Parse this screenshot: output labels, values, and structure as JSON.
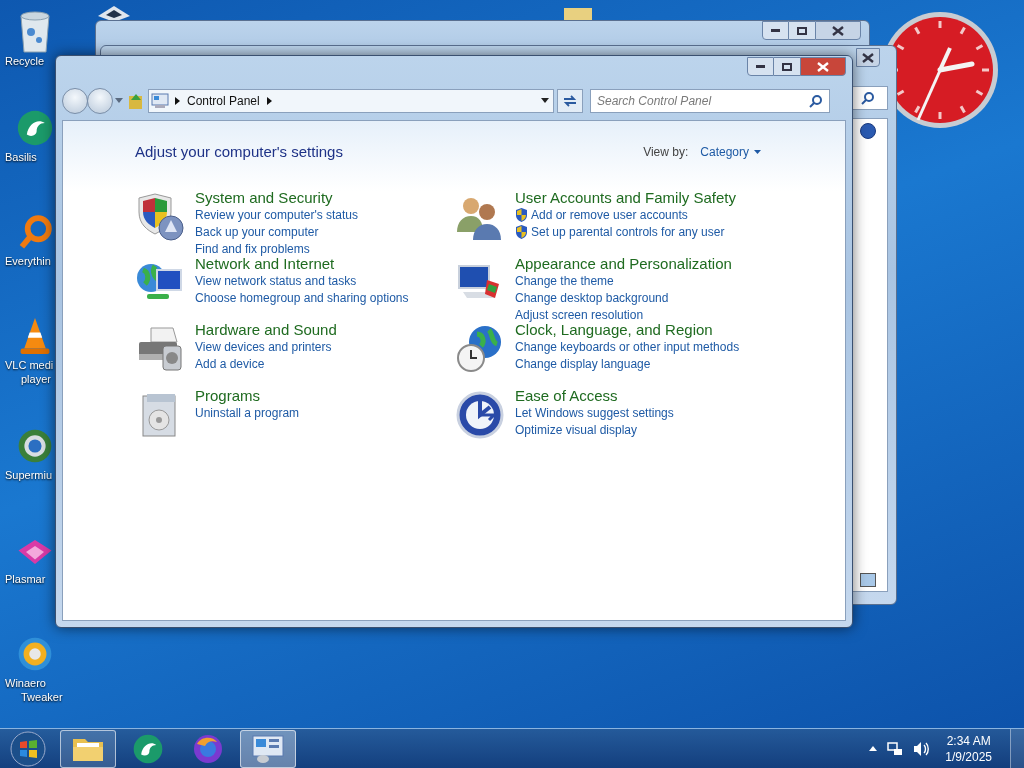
{
  "desktop_icons": [
    {
      "kind": "recycle",
      "label": "Recycle"
    },
    {
      "kind": "basilisk",
      "label": "Basilis"
    },
    {
      "kind": "everything",
      "label": "Everythin"
    },
    {
      "kind": "vlc",
      "label": "VLC medi",
      "label2": "player"
    },
    {
      "kind": "supermium",
      "label": "Supermiu"
    },
    {
      "kind": "plasma",
      "label": "Plasmar"
    },
    {
      "kind": "winaero",
      "label": "Winaero",
      "label2": "Tweaker"
    }
  ],
  "window": {
    "address": "Control Panel",
    "search": {
      "placeholder": "Search Control Panel"
    },
    "heading": "Adjust your computer's settings",
    "view_by": {
      "label": "View by:",
      "value": "Category"
    },
    "columns": [
      [
        {
          "title": "System and Security",
          "links": [
            {
              "text": "Review your computer's status",
              "shield": false
            },
            {
              "text": "Back up your computer",
              "shield": false
            },
            {
              "text": "Find and fix problems",
              "shield": false
            }
          ]
        },
        {
          "title": "Network and Internet",
          "links": [
            {
              "text": "View network status and tasks",
              "shield": false
            },
            {
              "text": "Choose homegroup and sharing options",
              "shield": false
            }
          ]
        },
        {
          "title": "Hardware and Sound",
          "links": [
            {
              "text": "View devices and printers",
              "shield": false
            },
            {
              "text": "Add a device",
              "shield": false
            }
          ]
        },
        {
          "title": "Programs",
          "links": [
            {
              "text": "Uninstall a program",
              "shield": false
            }
          ]
        }
      ],
      [
        {
          "title": "User Accounts and Family Safety",
          "links": [
            {
              "text": "Add or remove user accounts",
              "shield": true
            },
            {
              "text": "Set up parental controls for any user",
              "shield": true
            }
          ]
        },
        {
          "title": "Appearance and Personalization",
          "links": [
            {
              "text": "Change the theme",
              "shield": false
            },
            {
              "text": "Change desktop background",
              "shield": false
            },
            {
              "text": "Adjust screen resolution",
              "shield": false
            }
          ]
        },
        {
          "title": "Clock, Language, and Region",
          "links": [
            {
              "text": "Change keyboards or other input methods",
              "shield": false
            },
            {
              "text": "Change display language",
              "shield": false
            }
          ]
        },
        {
          "title": "Ease of Access",
          "links": [
            {
              "text": "Let Windows suggest settings",
              "shield": false
            },
            {
              "text": "Optimize visual display",
              "shield": false
            }
          ]
        }
      ]
    ]
  },
  "taskbar": {
    "items": [
      {
        "kind": "explorer",
        "running": true,
        "selected": false
      },
      {
        "kind": "basilisk",
        "running": false,
        "selected": false
      },
      {
        "kind": "firefox",
        "running": false,
        "selected": false
      },
      {
        "kind": "control-panel",
        "running": true,
        "selected": true
      }
    ],
    "time": "2:34 AM",
    "date": "1/9/2025"
  }
}
